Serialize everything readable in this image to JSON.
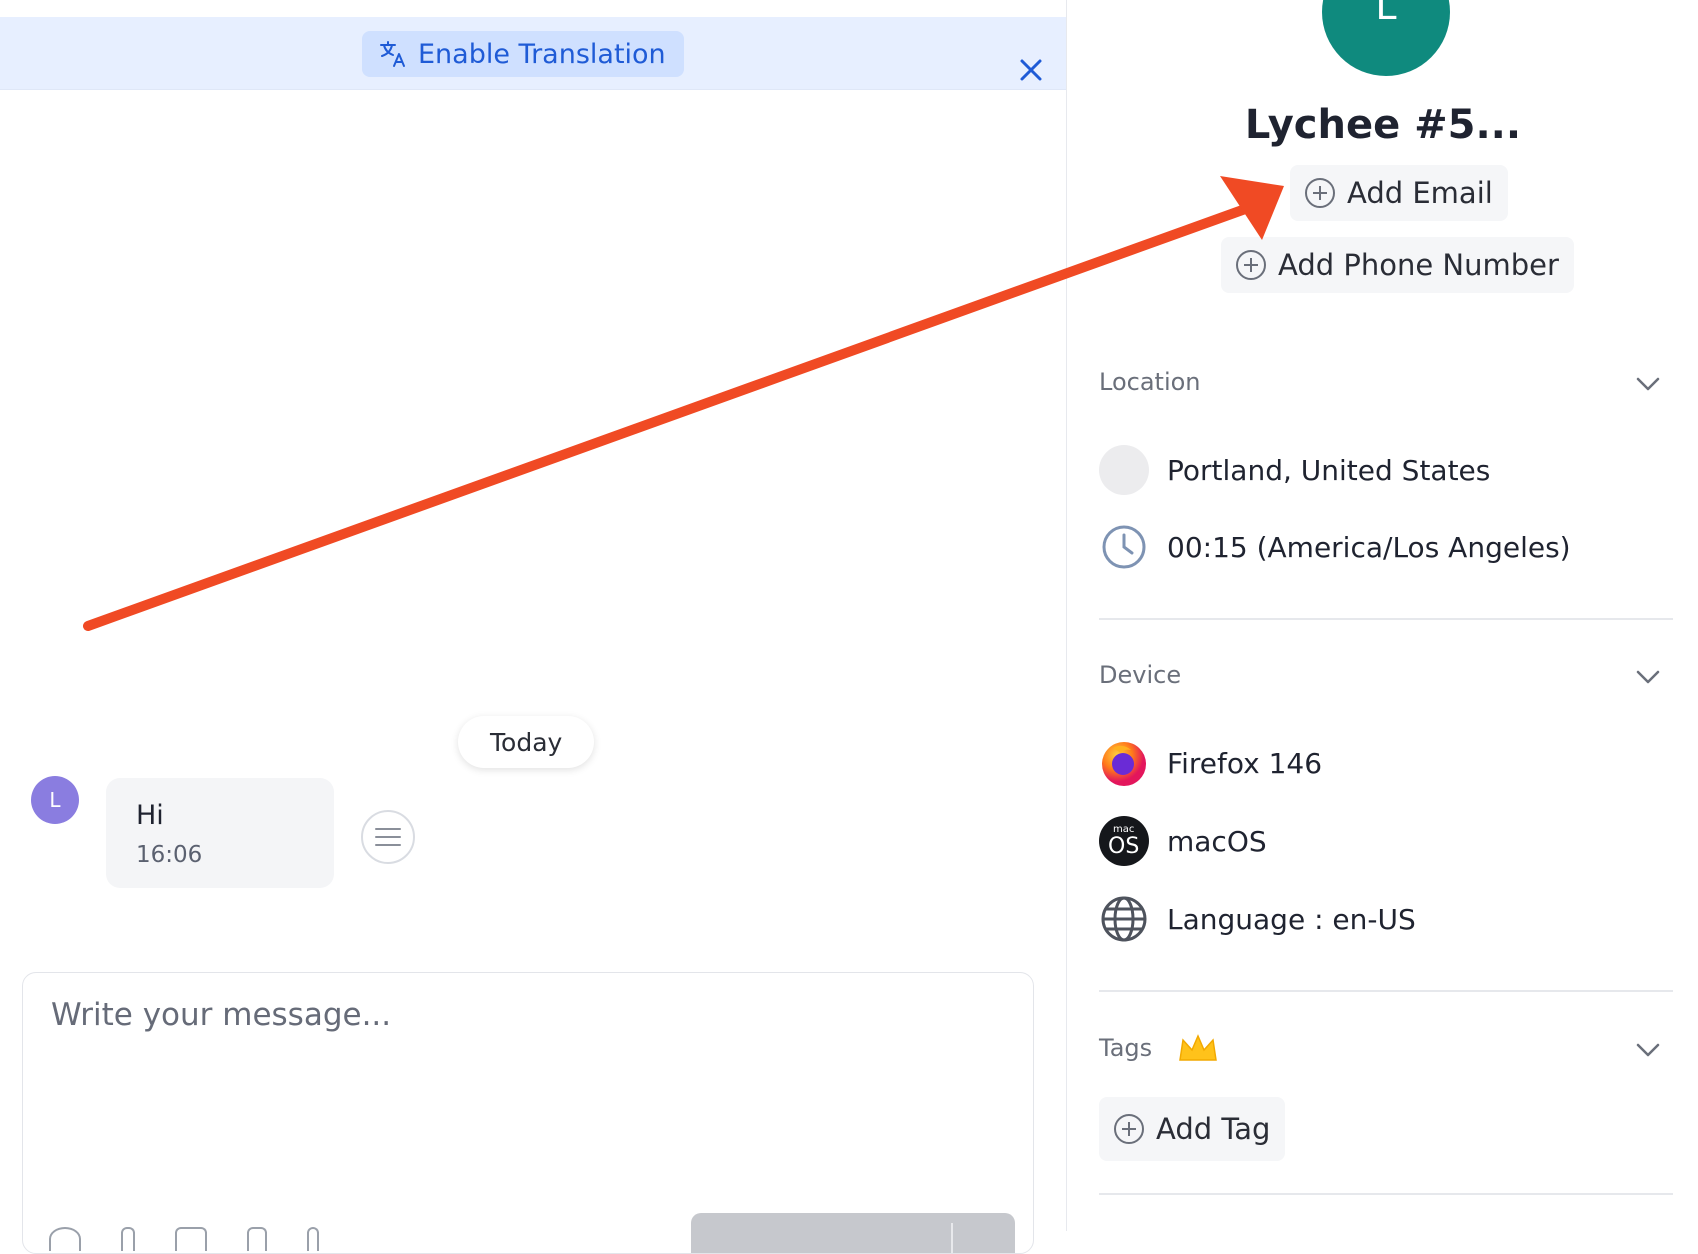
{
  "banner": {
    "translate_label": "Enable Translation"
  },
  "chat": {
    "day_label": "Today",
    "messages": [
      {
        "avatar_initial": "L",
        "text": "Hi",
        "time": "16:06"
      }
    ],
    "composer_placeholder": "Write your message..."
  },
  "contact": {
    "avatar_initial": "L",
    "avatar_color": "#0f8a7e",
    "name": "Lychee #5...",
    "add_email_label": "Add Email",
    "add_phone_label": "Add Phone Number"
  },
  "location": {
    "title": "Location",
    "place": "Portland, United States",
    "local_time": "00:15 (America/Los Angeles)"
  },
  "device": {
    "title": "Device",
    "browser": "Firefox 146",
    "os": "macOS",
    "os_icon_small": "mac",
    "os_icon_big": "OS",
    "language": "Language : en-US"
  },
  "tags": {
    "title": "Tags",
    "add_label": "Add Tag"
  },
  "colors": {
    "accent": "#1f5bd6",
    "annotation_arrow": "#f04a24"
  }
}
